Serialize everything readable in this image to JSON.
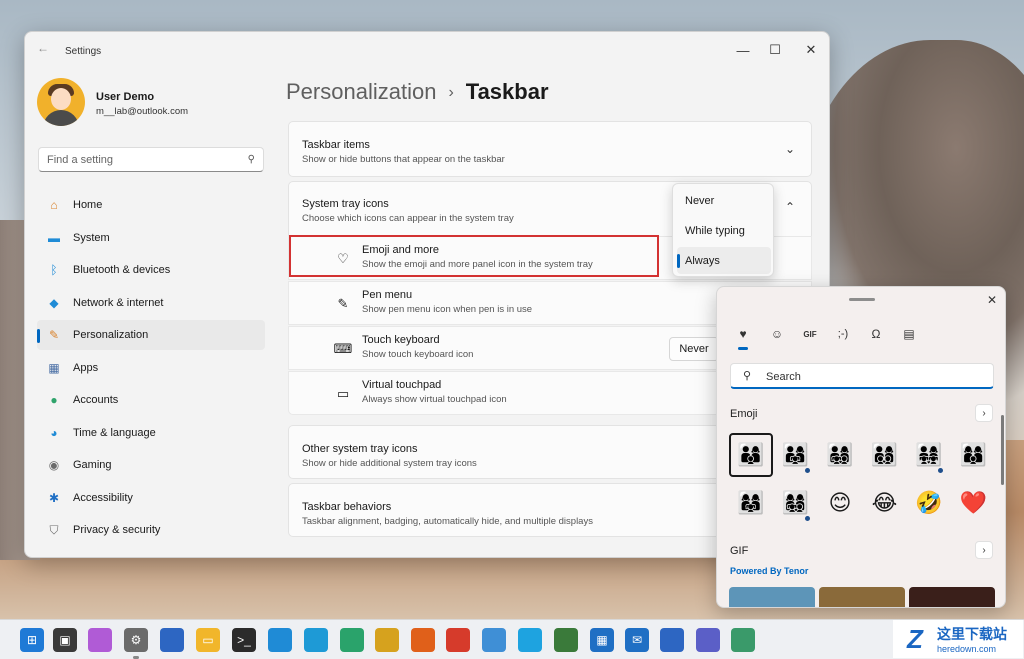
{
  "window": {
    "title": "Settings",
    "controls": {
      "minimize": "—",
      "maximize": "☐",
      "close": "✕"
    }
  },
  "profile": {
    "name": "User Demo",
    "email": "m__lab@outlook.com"
  },
  "search": {
    "placeholder": "Find a setting"
  },
  "sidebar": {
    "items": [
      {
        "label": "Home",
        "icon": "home-icon",
        "color": "#d9822b"
      },
      {
        "label": "System",
        "icon": "monitor-icon",
        "color": "#1f8bd6"
      },
      {
        "label": "Bluetooth & devices",
        "icon": "bluetooth-icon",
        "color": "#1f8bd6"
      },
      {
        "label": "Network & internet",
        "icon": "wifi-icon",
        "color": "#1f8bd6"
      },
      {
        "label": "Personalization",
        "icon": "brush-icon",
        "color": "#d9822b"
      },
      {
        "label": "Apps",
        "icon": "apps-icon",
        "color": "#4a6fa5"
      },
      {
        "label": "Accounts",
        "icon": "person-icon",
        "color": "#2fa36b"
      },
      {
        "label": "Time & language",
        "icon": "globe-clock-icon",
        "color": "#1f8bd6"
      },
      {
        "label": "Gaming",
        "icon": "gamepad-icon",
        "color": "#6b6b6b"
      },
      {
        "label": "Accessibility",
        "icon": "accessibility-icon",
        "color": "#1f6fc4"
      },
      {
        "label": "Privacy & security",
        "icon": "shield-icon",
        "color": "#6b6b6b"
      }
    ],
    "active_index": 4
  },
  "header": {
    "crumb": "Personalization",
    "separator": "›",
    "current": "Taskbar"
  },
  "sections": {
    "taskbar_items": {
      "title": "Taskbar items",
      "desc": "Show or hide buttons that appear on the taskbar"
    },
    "system_tray_icons": {
      "title": "System tray icons",
      "desc": "Choose which icons can appear in the system tray"
    },
    "other_tray": {
      "title": "Other system tray icons",
      "desc": "Show or hide additional system tray icons"
    },
    "behaviors": {
      "title": "Taskbar behaviors",
      "desc": "Taskbar alignment, badging, automatically hide, and multiple displays"
    }
  },
  "tray_rows": [
    {
      "title": "Emoji and more",
      "desc": "Show the emoji and more panel icon in the system tray",
      "icon": "emoji-heart-icon"
    },
    {
      "title": "Pen menu",
      "desc": "Show pen menu icon when pen is in use",
      "icon": "pen-icon"
    },
    {
      "title": "Touch keyboard",
      "desc": "Show touch keyboard icon",
      "icon": "keyboard-icon",
      "value": "Never"
    },
    {
      "title": "Virtual touchpad",
      "desc": "Always show virtual touchpad icon",
      "icon": "touchpad-icon"
    }
  ],
  "dropdown": {
    "options": [
      "Never",
      "While typing",
      "Always"
    ],
    "selected": "Always"
  },
  "emoji_panel": {
    "search_placeholder": "Search",
    "tabs": [
      "emoji-heart-icon",
      "smiley-icon",
      "gif-icon",
      "kaomoji-icon",
      "symbols-icon",
      "clipboard-icon"
    ],
    "emoji_section": "Emoji",
    "emojis": [
      "👨‍👩‍👦",
      "👨‍👩‍👧",
      "👨‍👩‍👧‍👦",
      "👨‍👩‍👦‍👦",
      "👨‍👩‍👧‍👧",
      "👩‍👩‍👦",
      "👩‍👩‍👧",
      "👩‍👩‍👧‍👦",
      "😊",
      "😂",
      "🤣",
      "❤️"
    ],
    "gif_section": "GIF",
    "powered_by": "Powered By Tenor",
    "more_glyph": "›"
  },
  "watermark": {
    "cn": "这里下载站",
    "en": "heredown.com",
    "logo": "Z"
  },
  "taskbar_icons": [
    {
      "name": "start-icon",
      "color": "#1f7ad6"
    },
    {
      "name": "task-view-icon",
      "color": "#3a3a3a"
    },
    {
      "name": "copilot-icon",
      "color": "#b05bd6"
    },
    {
      "name": "settings-icon",
      "color": "#6b6b6b"
    },
    {
      "name": "store-icon",
      "color": "#2d66c2"
    },
    {
      "name": "file-explorer-icon",
      "color": "#f1b62b"
    },
    {
      "name": "terminal-icon",
      "color": "#2b2b2b"
    },
    {
      "name": "edge-icon",
      "color": "#1f8bd6"
    },
    {
      "name": "edge-beta-icon",
      "color": "#1e9ad6"
    },
    {
      "name": "edge-dev-icon",
      "color": "#2aa36b"
    },
    {
      "name": "edge-canary-icon",
      "color": "#d6a21e"
    },
    {
      "name": "firefox-icon",
      "color": "#e0601a"
    },
    {
      "name": "chrome-icon",
      "color": "#d63b2b"
    },
    {
      "name": "photos-icon",
      "color": "#3f8fd6"
    },
    {
      "name": "skype-icon",
      "color": "#1ea3e0"
    },
    {
      "name": "solitaire-icon",
      "color": "#3a7a3a"
    },
    {
      "name": "calendar-icon",
      "color": "#1f6fc4"
    },
    {
      "name": "mail-icon",
      "color": "#1f6fc4"
    },
    {
      "name": "photo-editor-icon",
      "color": "#2d66c2"
    },
    {
      "name": "teams-icon",
      "color": "#5b5fc7"
    },
    {
      "name": "maps-icon",
      "color": "#3a9a6a"
    }
  ]
}
